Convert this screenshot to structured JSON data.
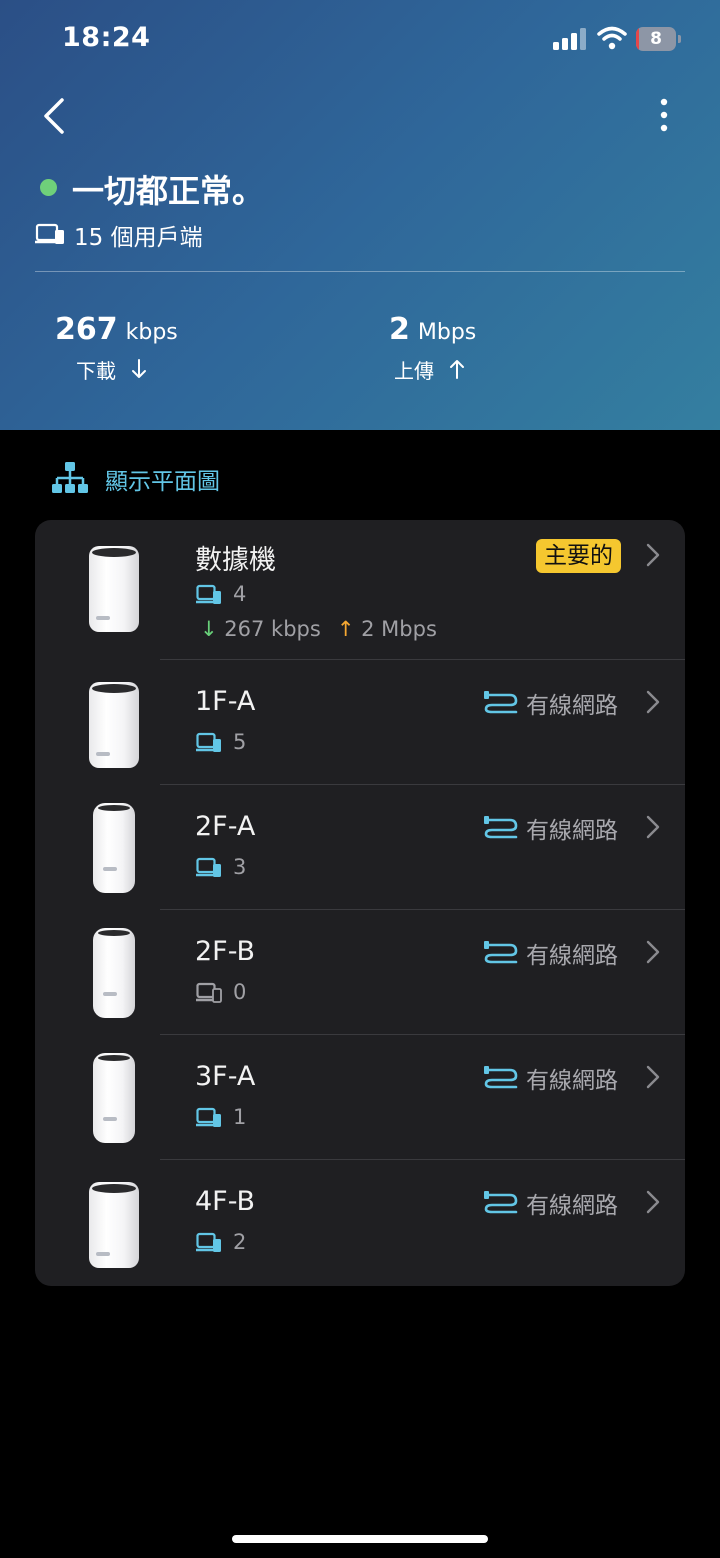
{
  "status_bar": {
    "time": "18:24",
    "battery": "8",
    "battery_color": "#e5474a"
  },
  "header": {
    "status_title": "一切都正常。",
    "status_color": "#6fd07a",
    "clients": "15 個用戶端",
    "download": {
      "value": "267",
      "unit": "kbps",
      "label": "下載"
    },
    "upload": {
      "value": "2",
      "unit": "Mbps",
      "label": "上傳"
    }
  },
  "floor_plan_link": "顯示平面圖",
  "devices": [
    {
      "name": "數據機",
      "clients": "4",
      "badge": "主要的",
      "down": "267 kbps",
      "up": "2 Mbps"
    },
    {
      "name": "1F-A",
      "clients": "5",
      "link": "有線網路"
    },
    {
      "name": "2F-A",
      "clients": "3",
      "link": "有線網路"
    },
    {
      "name": "2F-B",
      "clients": "0",
      "link": "有線網路"
    },
    {
      "name": "3F-A",
      "clients": "1",
      "link": "有線網路"
    },
    {
      "name": "4F-B",
      "clients": "2",
      "link": "有線網路"
    }
  ],
  "icons": {
    "back": "chevron-left-icon",
    "more": "more-vertical-icon",
    "client": "devices-icon",
    "floor": "network-topology-icon",
    "wired": "ethernet-cable-icon",
    "row": "chevron-right-icon"
  },
  "colors": {
    "accent": "#62c6e6",
    "badge": "#f5c72f",
    "download": "#68d07a",
    "upload": "#f6a832"
  }
}
